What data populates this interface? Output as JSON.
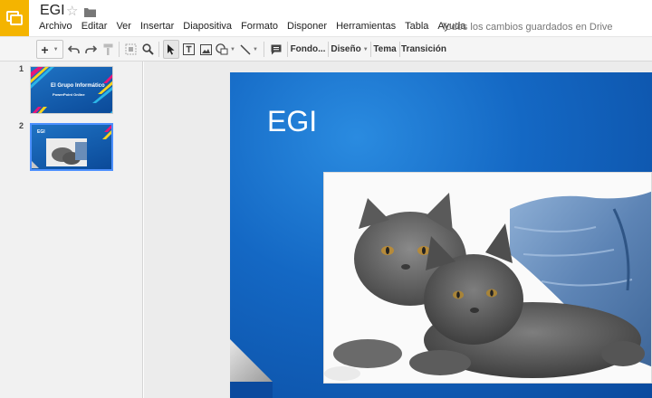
{
  "app": {
    "name": "Presentaciones de Google",
    "logo_icon": "slides-logo-icon",
    "brand_color": "#f4b400"
  },
  "document": {
    "title": "EGI",
    "star_icon": "star-icon",
    "folder_icon": "folder-icon"
  },
  "menu": {
    "items": [
      "Archivo",
      "Editar",
      "Ver",
      "Insertar",
      "Diapositiva",
      "Formato",
      "Disponer",
      "Herramientas",
      "Tabla",
      "Ayuda"
    ],
    "save_status": "Todos los cambios guardados en Drive"
  },
  "toolbar": {
    "new_slide_label": "+",
    "background_label": "Fondo...",
    "layout_label": "Diseño",
    "theme_label": "Tema",
    "transition_label": "Transición",
    "icons": [
      "add-icon",
      "undo-icon",
      "redo-icon",
      "paint-format-icon",
      "zoom-fit-icon",
      "zoom-icon",
      "select-icon",
      "text-box-icon",
      "image-icon",
      "shape-icon",
      "line-icon",
      "comment-icon"
    ]
  },
  "filmstrip": {
    "slides": [
      {
        "number": "1",
        "title": "El Grupo Informático",
        "subtitle": "PowerPoint Online"
      },
      {
        "number": "2",
        "title": "EGI"
      }
    ],
    "selected_index": 2,
    "selection_color": "#4d90fe"
  },
  "slide": {
    "title": "EGI",
    "image": "cats-photo",
    "background_color": "#1468c4"
  }
}
